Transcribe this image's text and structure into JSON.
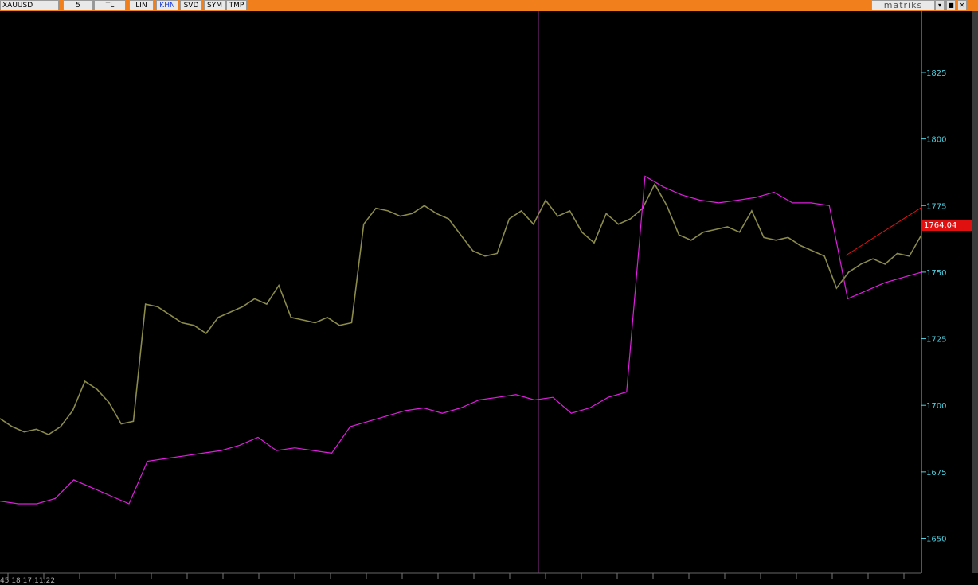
{
  "toolbar": {
    "symbol": "XAUUSD",
    "interval": "5",
    "buttons": [
      {
        "label": "TL",
        "active": false
      },
      {
        "label": "LIN",
        "active": false
      },
      {
        "label": "KHN",
        "active": true
      },
      {
        "label": "SVD",
        "active": false
      },
      {
        "label": "SYM",
        "active": false
      },
      {
        "label": "TMP",
        "active": false
      }
    ],
    "brand": "matriks",
    "window_buttons": [
      "▾",
      "■",
      "✕"
    ]
  },
  "status_bar": {
    "text": "45 18 17:11:22"
  },
  "chart_data": {
    "type": "line",
    "y_ticks": [
      1825,
      1800,
      1775,
      1750,
      1725,
      1700,
      1675,
      1650
    ],
    "ylim": [
      1637,
      1848
    ],
    "current_price_label": "1764.04",
    "series": [
      {
        "color": "#8b8b4a",
        "values": [
          1695,
          1692,
          1690,
          1691,
          1689,
          1692,
          1698,
          1709,
          1706,
          1701,
          1693,
          1694,
          1738,
          1737,
          1734,
          1731,
          1730,
          1727,
          1733,
          1735,
          1737,
          1740,
          1738,
          1745,
          1733,
          1732,
          1731,
          1733,
          1730,
          1731,
          1768,
          1774,
          1773,
          1771,
          1772,
          1775,
          1772,
          1770,
          1764,
          1758,
          1756,
          1757,
          1770,
          1773,
          1768,
          1777,
          1771,
          1773,
          1765,
          1761,
          1772,
          1768,
          1770,
          1774,
          1783,
          1775,
          1764,
          1762,
          1765,
          1766,
          1767,
          1765,
          1773,
          1763,
          1762,
          1763,
          1760,
          1758,
          1756,
          1744,
          1750,
          1753,
          1755,
          1753,
          1757,
          1756,
          1764
        ]
      },
      {
        "color": "#e01ee0",
        "values": [
          1664,
          1663,
          1663,
          1665,
          1672,
          1669,
          1666,
          1663,
          1679,
          1680,
          1681,
          1682,
          1683,
          1685,
          1688,
          1683,
          1684,
          1683,
          1682,
          1692,
          1694,
          1696,
          1698,
          1699,
          1697,
          1699,
          1702,
          1703,
          1704,
          1702,
          1703,
          1697,
          1699,
          1703,
          1705,
          1786,
          1782,
          1779,
          1777,
          1776,
          1777,
          1778,
          1780,
          1776,
          1776,
          1775,
          1740,
          1743,
          1746,
          1748,
          1750
        ]
      }
    ]
  }
}
